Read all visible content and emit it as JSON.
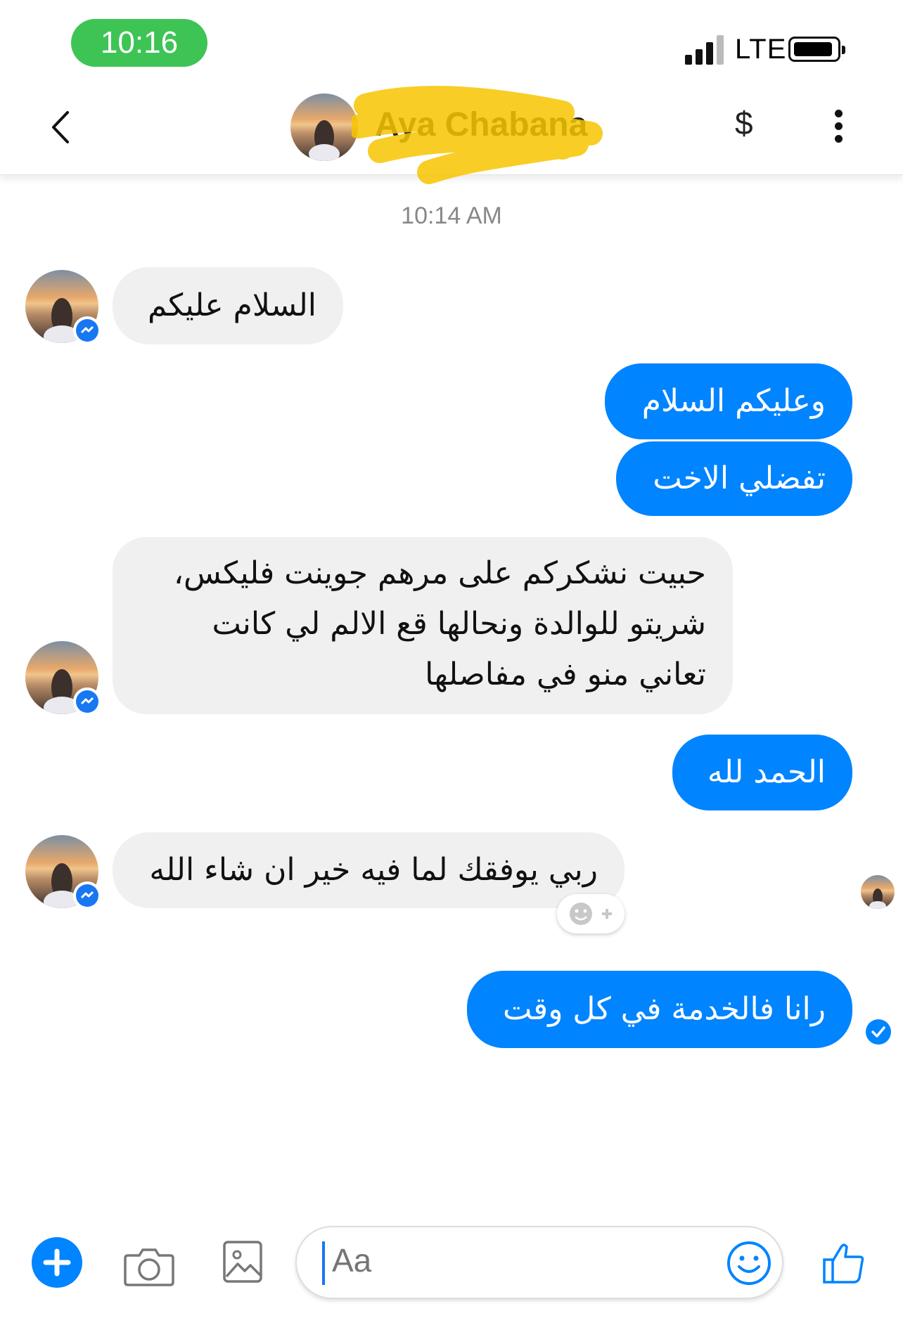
{
  "status_bar": {
    "time": "10:16",
    "network": "LTE"
  },
  "header": {
    "contact_name": "Aya Chabana",
    "payment_symbol": "$"
  },
  "conversation": {
    "timestamp": "10:14 AM",
    "messages": [
      {
        "direction": "incoming",
        "lines": [
          "السلام عليكم"
        ]
      },
      {
        "direction": "outgoing",
        "lines": [
          "وعليكم السلام"
        ]
      },
      {
        "direction": "outgoing",
        "lines": [
          "تفضلي الاخت"
        ]
      },
      {
        "direction": "incoming",
        "lines": [
          "حبيت نشكركم على مرهم جوينت فليكس،",
          "شريتو للوالدة ونحالها قع الالم لي كانت",
          "تعاني منو في مفاصلها"
        ]
      },
      {
        "direction": "outgoing",
        "lines": [
          "الحمد لله"
        ]
      },
      {
        "direction": "incoming",
        "lines": [
          "ربي يوفقك لما فيه خير ان شاء الله"
        ]
      },
      {
        "direction": "outgoing",
        "lines": [
          "رانا فالخدمة في كل وقت"
        ]
      }
    ]
  },
  "composer": {
    "placeholder": "Aa"
  },
  "colors": {
    "accent": "#0084ff",
    "incoming_bubble": "#f0f0f0",
    "status_pill": "#3ec455"
  },
  "icons": [
    "back-icon",
    "more-icon",
    "react-icon",
    "plus-icon",
    "camera-icon",
    "gallery-icon",
    "emoji-icon",
    "like-icon",
    "messenger-badge-icon",
    "delivered-check-icon"
  ]
}
